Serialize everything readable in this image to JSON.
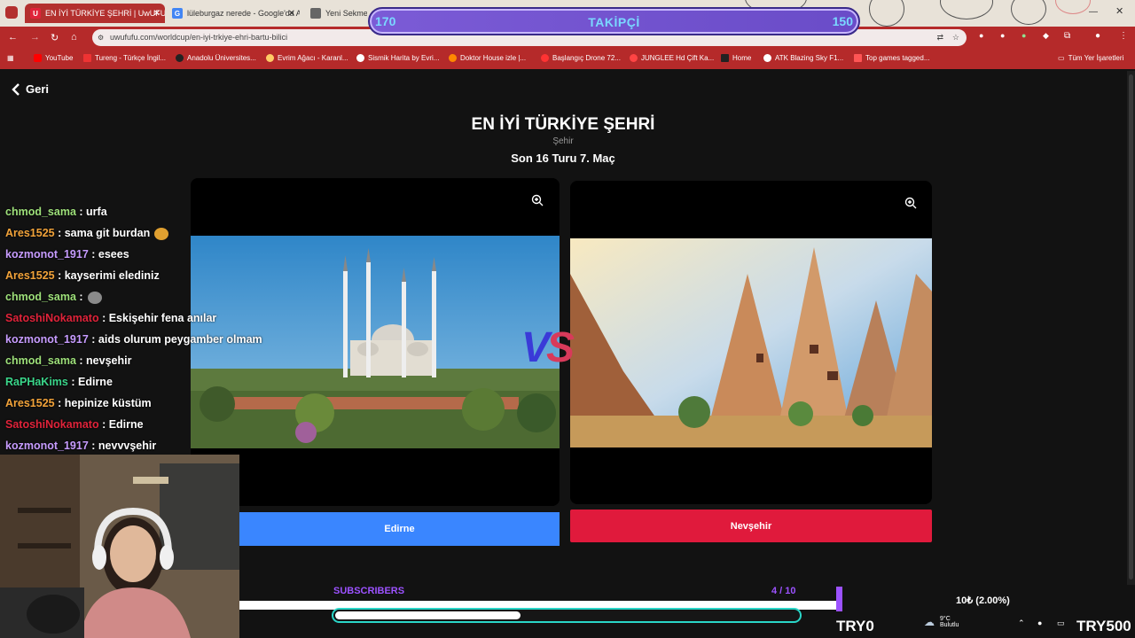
{
  "browser": {
    "tabs": [
      {
        "title": "EN İYİ TÜRKİYE ŞEHRİ | UwUFUfU",
        "active": true
      },
      {
        "title": "lüleburgaz nerede - Google'da Ara",
        "active": false
      },
      {
        "title": "Yeni Sekme",
        "active": false
      }
    ],
    "url": "uwufufu.com/worldcup/en-iyi-trkiye-ehri-bartu-bilici",
    "bookmarks": [
      "YouTube",
      "Tureng - Türkçe İngil...",
      "Anadolu Üniversites...",
      "Evrim Ağacı - Karanl...",
      "Sismik Harita by Evri...",
      "Doktor House izle |...",
      "Başlangıç Drone 72...",
      "JUNGLEE Hd Çift Ka...",
      "Home",
      "ATK Blazing Sky F1...",
      "Top games tagged..."
    ],
    "bookmarks_right": "Tüm Yer İşaretleri"
  },
  "overlay_followers": {
    "left": "170",
    "label": "TAKİPÇİ",
    "right": "150"
  },
  "page": {
    "back_label": "Geri",
    "title": "EN İYİ TÜRKİYE ŞEHRİ",
    "category": "Şehir",
    "round": "Son 16 Turu 7. Maç",
    "vs_a": "V",
    "vs_b": "S",
    "left_choice": "Edirne",
    "right_choice": "Nevşehir"
  },
  "chat": [
    {
      "user": "chmod_sama",
      "text": ": urfa",
      "color": "#9ee07a"
    },
    {
      "user": "Ares1525",
      "text": ": sama git burdan",
      "color": "#f2a33a",
      "emote": "#e0a030"
    },
    {
      "user": "kozmonot_1917",
      "text": ": esees",
      "color": "#c79cff"
    },
    {
      "user": "Ares1525",
      "text": ": kayserimi elediniz",
      "color": "#f2a33a"
    },
    {
      "user": "chmod_sama",
      "text": ":",
      "color": "#9ee07a",
      "emote": "#8a8a8a"
    },
    {
      "user": "SatoshiNokamato",
      "text": ": Eskişehir fena anılar",
      "color": "#e0233a"
    },
    {
      "user": "kozmonot_1917",
      "text": ": aids olurum peygamber olmam",
      "color": "#c79cff"
    },
    {
      "user": "chmod_sama",
      "text": ": nevşehir",
      "color": "#9ee07a"
    },
    {
      "user": "RaPHaKims",
      "text": ": Edirne",
      "color": "#3ad68a"
    },
    {
      "user": "Ares1525",
      "text": ": hepinize küstüm",
      "color": "#f2a33a"
    },
    {
      "user": "SatoshiNokamato",
      "text": ": Edirne",
      "color": "#e0233a"
    },
    {
      "user": "kozmonot_1917",
      "text": ": nevvvşehir",
      "color": "#c79cff"
    }
  ],
  "subs": {
    "label": "SUBSCRIBERS",
    "count": "4 / 10",
    "progress": 0.4
  },
  "donation": {
    "left": "TRY0",
    "percent": "10₺ (2.00%)",
    "right": "TRY500"
  },
  "taskbar": {
    "weather_temp": "9°C",
    "weather_text": "Bulutlu"
  }
}
